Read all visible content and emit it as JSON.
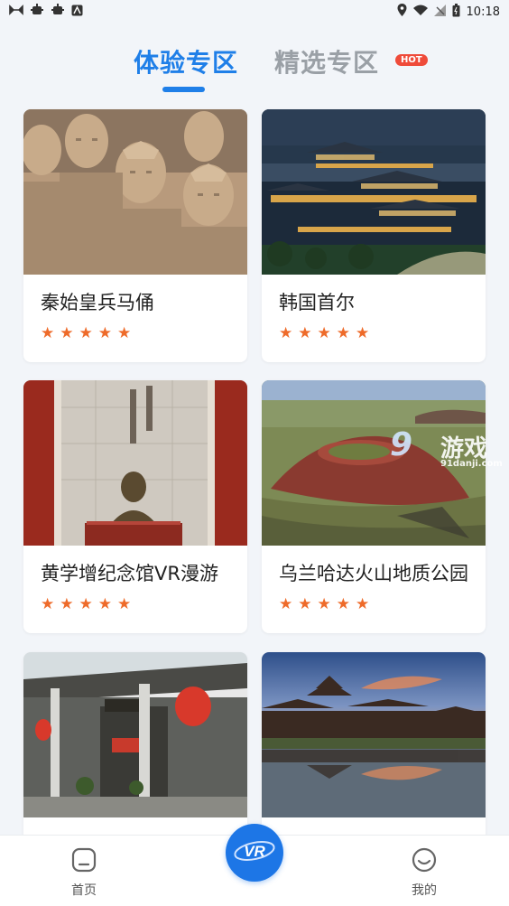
{
  "status": {
    "time": "10:18",
    "icons": [
      "game-controller-icon",
      "bug-icon",
      "bug-icon",
      "a-icon",
      "location-icon",
      "wifi-icon",
      "signal-off-icon",
      "battery-icon"
    ]
  },
  "tabs": {
    "active_label": "体验专区",
    "inactive_label": "精选专区",
    "hot_badge": "HOT"
  },
  "cards": [
    {
      "title": "秦始皇兵马俑",
      "rating": 5
    },
    {
      "title": "韩国首尔",
      "rating": 5
    },
    {
      "title": "黄学增纪念馆VR漫游",
      "rating": 5
    },
    {
      "title": "乌兰哈达火山地质公园",
      "rating": 5
    },
    {
      "title": "",
      "rating": 0
    },
    {
      "title": "",
      "rating": 0
    }
  ],
  "watermark": {
    "big": "9",
    "cn": "游戏",
    "url": "91danji.com"
  },
  "bottom_nav": {
    "home_label": "首页",
    "center_label": "VR",
    "profile_label": "我的"
  },
  "colors": {
    "accent": "#1f7fe8",
    "star": "#ee6b2a",
    "hot": "#ef4b3a"
  }
}
